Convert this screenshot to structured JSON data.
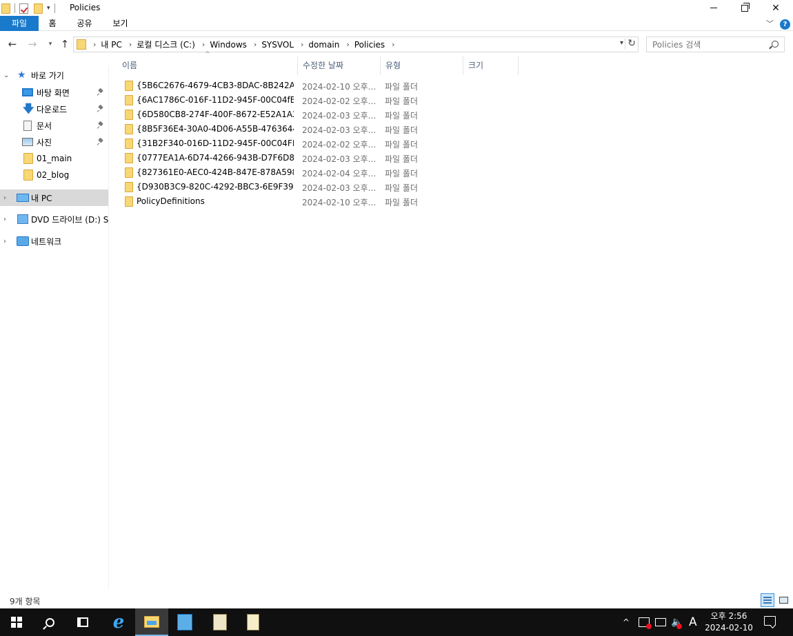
{
  "window": {
    "title": "Policies",
    "controls": {
      "minimize": "minimize-icon",
      "maximize": "restore-icon",
      "close": "close-icon"
    }
  },
  "ribbon": {
    "tabs": [
      "파일",
      "홈",
      "공유",
      "보기"
    ],
    "accent_color": "#1979ca"
  },
  "address": {
    "breadcrumb": [
      "내 PC",
      "로컬 디스크 (C:)",
      "Windows",
      "SYSVOL",
      "domain",
      "Policies"
    ],
    "search_placeholder": "Policies 검색"
  },
  "navigation": {
    "quick_access_label": "바로 가기",
    "quick_access": [
      {
        "label": "바탕 화면",
        "icon": "desktop-icon",
        "pinned": true
      },
      {
        "label": "다운로드",
        "icon": "download-icon",
        "pinned": true
      },
      {
        "label": "문서",
        "icon": "document-icon",
        "pinned": true
      },
      {
        "label": "사진",
        "icon": "pictures-icon",
        "pinned": true
      },
      {
        "label": "01_main",
        "icon": "folder-icon",
        "pinned": false
      },
      {
        "label": "02_blog",
        "icon": "folder-icon",
        "pinned": false
      }
    ],
    "this_pc": "내 PC",
    "dvd_drive": "DVD 드라이브 (D:) S",
    "network": "네트워크"
  },
  "columns": {
    "name": "이름",
    "modified": "수정한 날짜",
    "type": "유형",
    "size": "크기"
  },
  "files": [
    {
      "name": "{5B6C2676-4679-4CB3-8DAC-8B242A...",
      "modified": "2024-02-10 오후...",
      "type": "파일 폴더"
    },
    {
      "name": "{6AC1786C-016F-11D2-945F-00C04fB...",
      "modified": "2024-02-02 오후...",
      "type": "파일 폴더"
    },
    {
      "name": "{6D580CB8-274F-400F-8672-E52A1A2...",
      "modified": "2024-02-03 오후...",
      "type": "파일 폴더"
    },
    {
      "name": "{8B5F36E4-30A0-4D06-A55B-4763644...",
      "modified": "2024-02-03 오후...",
      "type": "파일 폴더"
    },
    {
      "name": "{31B2F340-016D-11D2-945F-00C04FB...",
      "modified": "2024-02-02 오후...",
      "type": "파일 폴더"
    },
    {
      "name": "{0777EA1A-6D74-4266-943B-D7F6D8...",
      "modified": "2024-02-03 오후...",
      "type": "파일 폴더"
    },
    {
      "name": "{827361E0-AEC0-424B-847E-878A598...",
      "modified": "2024-02-04 오후...",
      "type": "파일 폴더"
    },
    {
      "name": "{D930B3C9-820C-4292-BBC3-6E9F39...",
      "modified": "2024-02-03 오후...",
      "type": "파일 폴더"
    },
    {
      "name": "PolicyDefinitions",
      "modified": "2024-02-10 오후...",
      "type": "파일 폴더"
    }
  ],
  "status": {
    "item_count": "9개 항목"
  },
  "taskbar": {
    "apps": [
      "start-icon",
      "search-icon",
      "task-view-icon",
      "internet-explorer-icon",
      "file-explorer-icon",
      "server-manager-icon",
      "script-icon",
      "notepad-icon"
    ],
    "active_app": "file-explorer-icon",
    "ime": "A",
    "time": "오후 2:56",
    "date": "2024-02-10"
  }
}
